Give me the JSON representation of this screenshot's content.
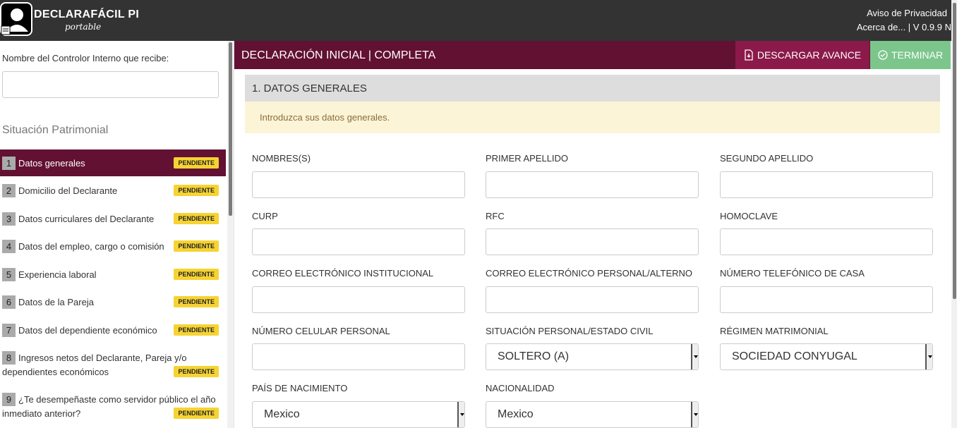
{
  "app": {
    "title": "DECLARAFÁCIL PI",
    "subtitle": "portable",
    "links": [
      "Aviso de Privacidad",
      "Acerca de... | V 0.9.9 N"
    ]
  },
  "sidebar": {
    "contralor_label": "Nombre del Controlor Interno que recibe:",
    "contralor_value": "",
    "section_title": "Situación Patrimonial",
    "items": [
      {
        "num": "1",
        "label": "Datos generales",
        "status": "PENDIENTE"
      },
      {
        "num": "2",
        "label": "Domicilio del Declarante",
        "status": "PENDIENTE"
      },
      {
        "num": "3",
        "label": "Datos curriculares del Declarante",
        "status": "PENDIENTE"
      },
      {
        "num": "4",
        "label": "Datos del empleo, cargo o comisión",
        "status": "PENDIENTE"
      },
      {
        "num": "5",
        "label": "Experiencia laboral",
        "status": "PENDIENTE"
      },
      {
        "num": "6",
        "label": "Datos de la Pareja",
        "status": "PENDIENTE"
      },
      {
        "num": "7",
        "label": "Datos del dependiente económico",
        "status": "PENDIENTE"
      },
      {
        "num": "8",
        "label": "Ingresos netos del Declarante, Pareja y/o dependientes económicos",
        "status": "PENDIENTE"
      },
      {
        "num": "9",
        "label": "¿Te desempeñaste como servidor público el año inmediato anterior?",
        "status": "PENDIENTE"
      }
    ]
  },
  "main": {
    "header_title": "DECLARACIÓN INICIAL | COMPLETA",
    "download_label": "DESCARGAR AVANCE",
    "finish_label": "TERMINAR",
    "panel_title": "1. DATOS GENERALES",
    "alert_text": "Introduzca sus datos generales.",
    "fields": {
      "nombres": "NOMBRES(S)",
      "primer_apellido": "PRIMER APELLIDO",
      "segundo_apellido": "SEGUNDO APELLIDO",
      "curp": "CURP",
      "rfc": "RFC",
      "homoclave": "HOMOCLAVE",
      "correo_institucional": "CORREO ELECTRÓNICO INSTITUCIONAL",
      "correo_personal": "CORREO ELECTRÓNICO PERSONAL/ALTERNO",
      "telefono_casa": "NÚMERO TELEFÓNICO DE CASA",
      "celular": "NÚMERO CELULAR PERSONAL",
      "estado_civil": "SITUACIÓN PERSONAL/ESTADO CIVIL",
      "regimen": "RÉGIMEN MATRIMONIAL",
      "pais_nacimiento": "PAÍS DE NACIMIENTO",
      "nacionalidad": "NACIONALIDAD"
    },
    "selects": {
      "estado_civil": "SOLTERO (A)",
      "regimen": "SOCIEDAD CONYUGAL",
      "pais_nacimiento": "Mexico",
      "nacionalidad": "Mexico"
    }
  },
  "colors": {
    "topbar": "#333333",
    "brand": "#621132",
    "download": "#8b1a4a",
    "finish": "#7cc68c",
    "badge": "#f6d332",
    "alert_bg": "#fcf4d6"
  }
}
